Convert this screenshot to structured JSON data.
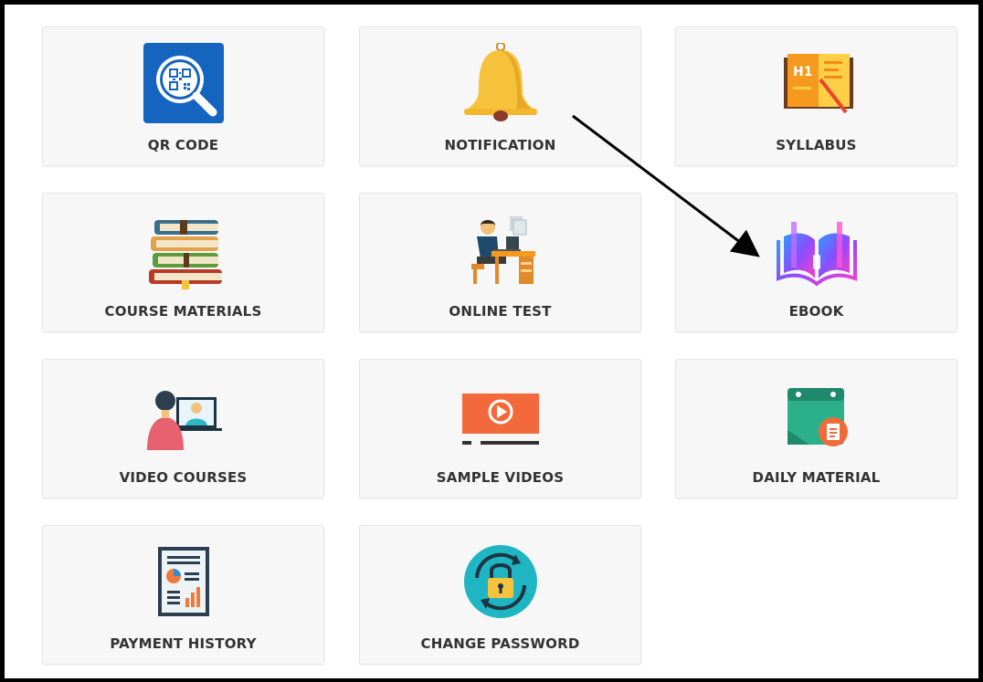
{
  "tiles": [
    {
      "label": "QR CODE",
      "icon": "qr-code-icon"
    },
    {
      "label": "NOTIFICATION",
      "icon": "bell-icon"
    },
    {
      "label": "SYLLABUS",
      "icon": "syllabus-book-icon"
    },
    {
      "label": "COURSE MATERIALS",
      "icon": "books-stack-icon"
    },
    {
      "label": "ONLINE TEST",
      "icon": "person-at-desk-icon"
    },
    {
      "label": "EBOOK",
      "icon": "open-ebook-icon"
    },
    {
      "label": "VIDEO COURSES",
      "icon": "video-call-icon"
    },
    {
      "label": "SAMPLE VIDEOS",
      "icon": "play-video-icon"
    },
    {
      "label": "DAILY MATERIAL",
      "icon": "calendar-document-icon"
    },
    {
      "label": "PAYMENT HISTORY",
      "icon": "report-chart-icon"
    },
    {
      "label": "CHANGE PASSWORD",
      "icon": "lock-refresh-icon"
    }
  ],
  "colors": {
    "tile_bg": "#f7f7f7",
    "label": "#333333",
    "arrow": "#000000"
  }
}
